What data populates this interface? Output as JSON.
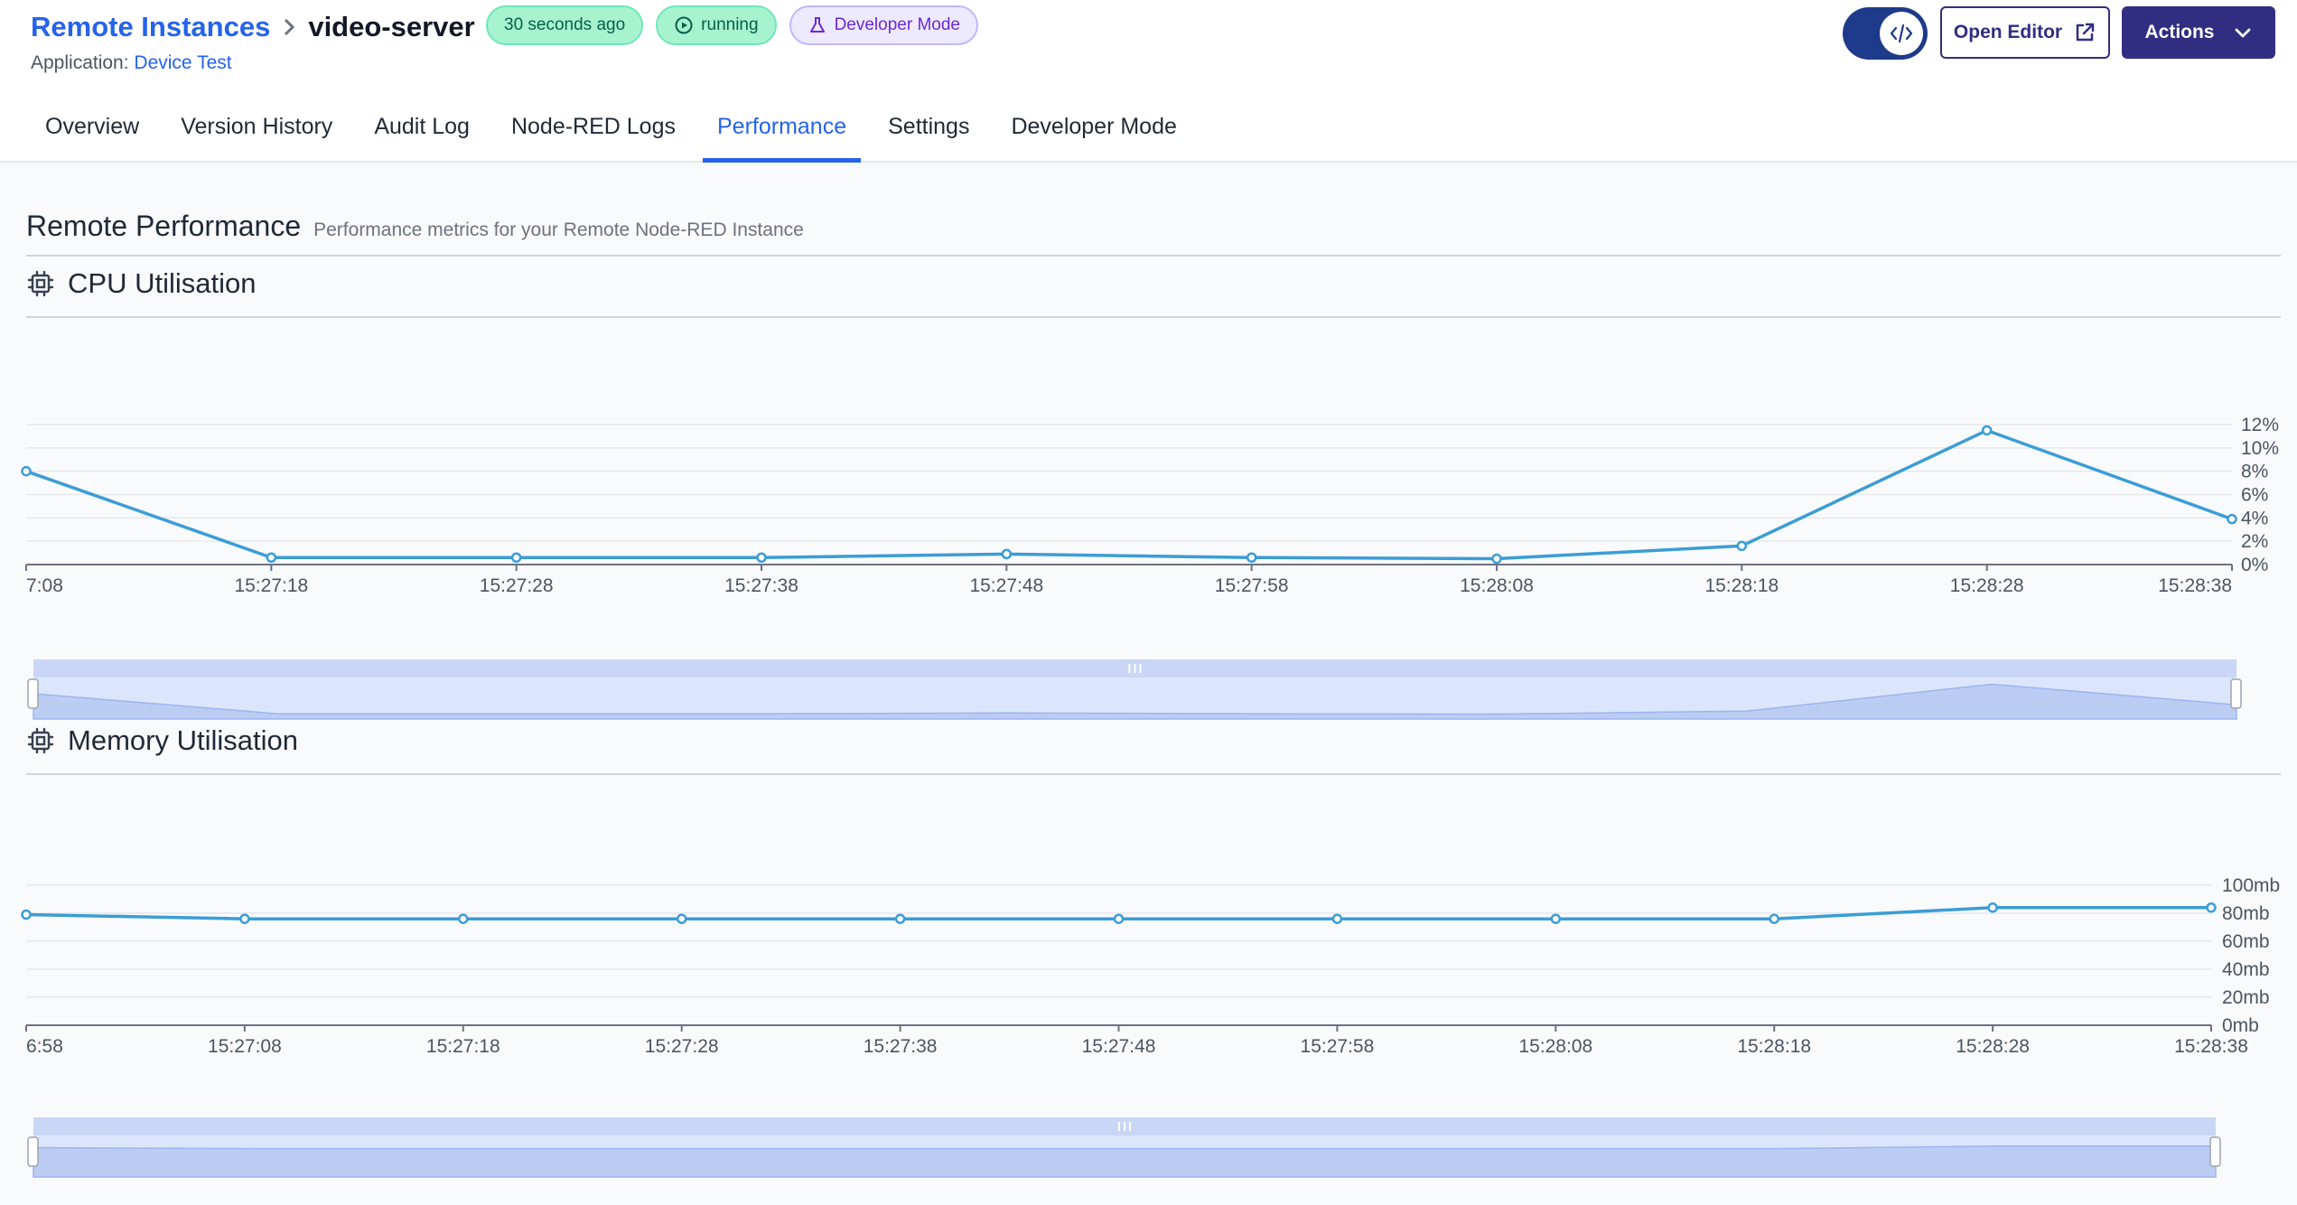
{
  "breadcrumb": {
    "parent": "Remote Instances",
    "current": "video-server"
  },
  "badges": {
    "updated": "30 seconds ago",
    "status": "running",
    "mode": "Developer Mode"
  },
  "application": {
    "label": "Application:",
    "name": "Device Test"
  },
  "header_buttons": {
    "open_editor": "Open Editor",
    "actions": "Actions"
  },
  "tabs": [
    {
      "label": "Overview"
    },
    {
      "label": "Version History"
    },
    {
      "label": "Audit Log"
    },
    {
      "label": "Node-RED Logs"
    },
    {
      "label": "Performance",
      "active": true
    },
    {
      "label": "Settings"
    },
    {
      "label": "Developer Mode"
    }
  ],
  "section": {
    "title": "Remote Performance",
    "subtitle": "Performance metrics for your Remote Node-RED Instance"
  },
  "colors": {
    "accent": "#2563eb",
    "series": "#3b9dd6",
    "primary_button": "#312e81"
  },
  "chart_data": [
    {
      "type": "line",
      "title": "CPU Utilisation",
      "x": [
        "7:08",
        "15:27:18",
        "15:27:28",
        "15:27:38",
        "15:27:48",
        "15:27:58",
        "15:28:08",
        "15:28:18",
        "15:28:28",
        "15:28:38"
      ],
      "values": [
        8.0,
        0.6,
        0.6,
        0.6,
        0.9,
        0.6,
        0.5,
        1.6,
        11.5,
        3.9
      ],
      "y_ticks": [
        "0%",
        "2%",
        "4%",
        "6%",
        "8%",
        "10%",
        "12%"
      ],
      "ylim": [
        0,
        12
      ],
      "grid": true
    },
    {
      "type": "line",
      "title": "Memory Utilisation",
      "x": [
        "6:58",
        "15:27:08",
        "15:27:18",
        "15:27:28",
        "15:27:38",
        "15:27:48",
        "15:27:58",
        "15:28:08",
        "15:28:18",
        "15:28:28",
        "15:28:38"
      ],
      "values": [
        79,
        76,
        76,
        76,
        76,
        76,
        76,
        76,
        76,
        84,
        84
      ],
      "y_ticks": [
        "0mb",
        "20mb",
        "40mb",
        "60mb",
        "80mb",
        "100mb"
      ],
      "ylim": [
        0,
        100
      ],
      "grid": true
    }
  ]
}
